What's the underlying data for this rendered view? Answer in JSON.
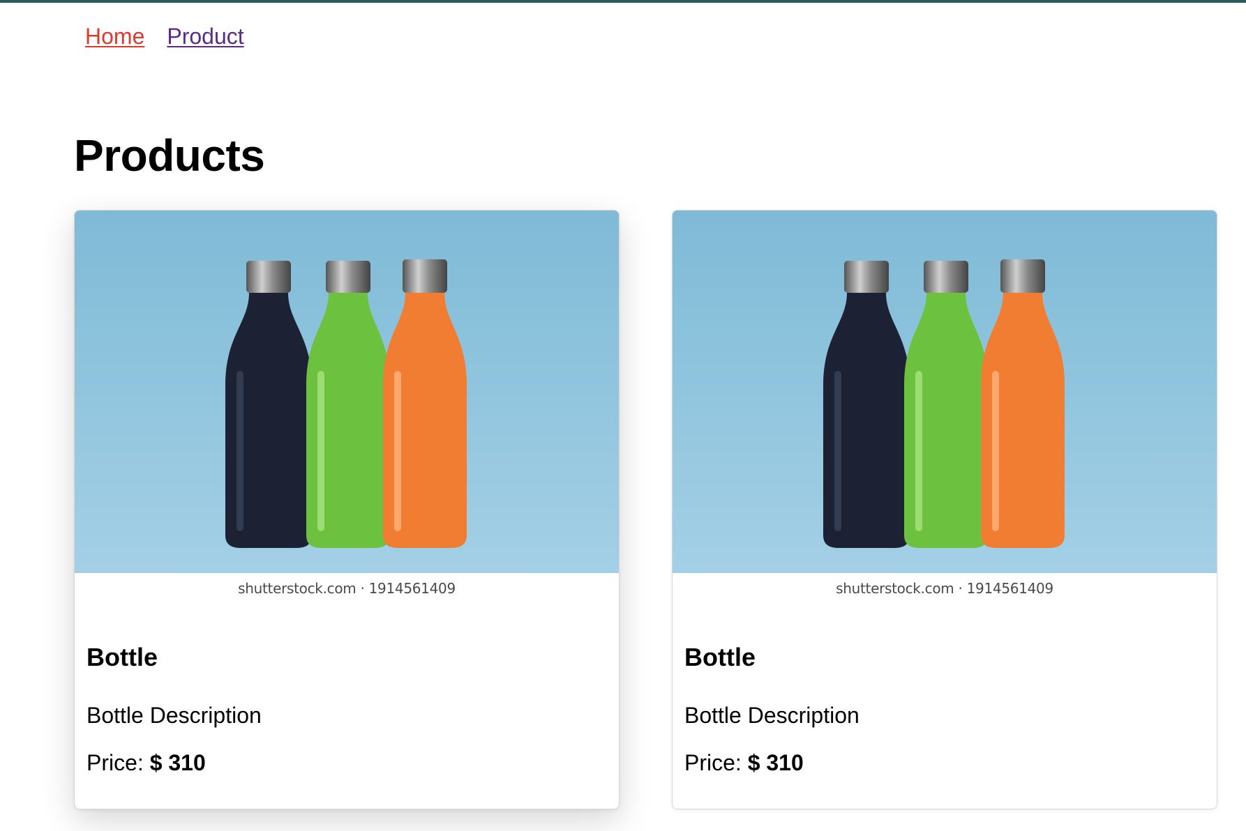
{
  "nav": {
    "home_label": "Home",
    "product_label": "Product"
  },
  "page": {
    "title": "Products"
  },
  "products": [
    {
      "name": "Bottle",
      "description": "Bottle Description",
      "price_label": "Price:",
      "price": "$ 310",
      "image_caption": "shutterstock.com · 1914561409",
      "image_icon": "three-bottles-image"
    },
    {
      "name": "Bottle",
      "description": "Bottle Description",
      "price_label": "Price:",
      "price": "$ 310",
      "image_caption": "shutterstock.com · 1914561409",
      "image_icon": "three-bottles-image"
    }
  ],
  "colors": {
    "top_strip": "#2b5a5c",
    "home_link": "#e0392a",
    "product_link": "#5b2a8a",
    "image_background": "#8cc4dd",
    "bottle_navy": "#1c2233",
    "bottle_green": "#6cc23f",
    "bottle_orange": "#f07d32",
    "bottle_cap": "#8a8a8a"
  }
}
